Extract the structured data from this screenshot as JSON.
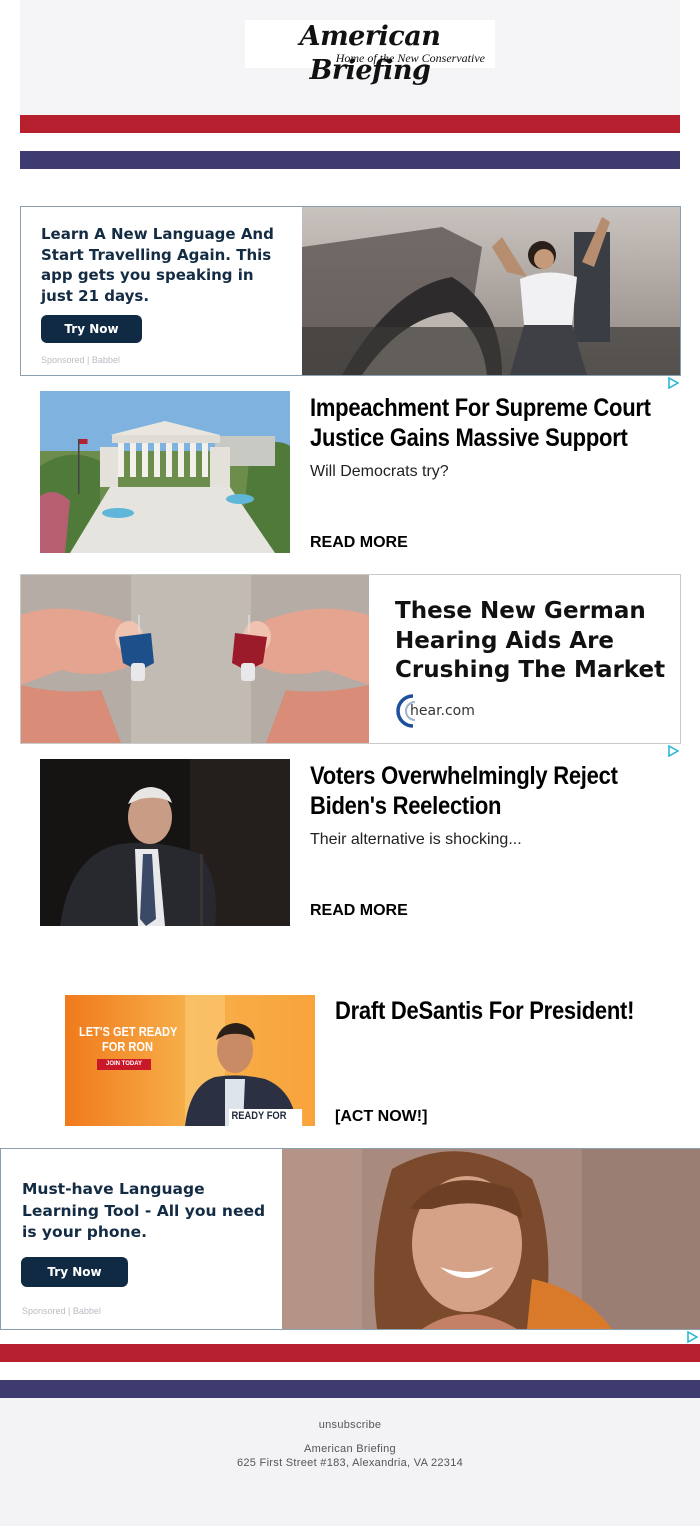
{
  "brand": {
    "title": "American Briefing",
    "tagline": "Home of the New Conservative"
  },
  "colors": {
    "red": "#b51f2e",
    "navy": "#3d3b6f",
    "ad_text": "#132c44"
  },
  "ad1": {
    "headline": "Learn A New Language And Start Travelling Again. This app gets you speaking in just 21 days.",
    "button": "Try Now",
    "sponsor": "Sponsored | Babbel"
  },
  "article1": {
    "headline": "Impeachment For Supreme Court Justice Gains Massive Support",
    "sub": "Will Democrats try?",
    "cta": "READ MORE"
  },
  "ad2": {
    "headline": "These New German Hearing Aids Are Crushing The Market",
    "brand": "hear.com"
  },
  "article2": {
    "headline": "Voters Overwhelmingly Reject Biden's Reelection",
    "sub": "Their alternative is shocking...",
    "cta": "READ MORE"
  },
  "article3": {
    "headline": "Draft DeSantis For President!",
    "cta": "[ACT NOW!]",
    "image_text": {
      "line1": "LET'S GET READY",
      "line2": "FOR RON",
      "chip": "JOIN TODAY",
      "badge": "READY FOR RON"
    }
  },
  "ad3": {
    "headline": "Must-have Language Learning Tool - All you need is your phone.",
    "button": "Try Now",
    "sponsor": "Sponsored | Babbel"
  },
  "footer": {
    "unsubscribe": "unsubscribe",
    "org": "American Briefing",
    "address": "625 First Street #183, Alexandria, VA 22314"
  }
}
